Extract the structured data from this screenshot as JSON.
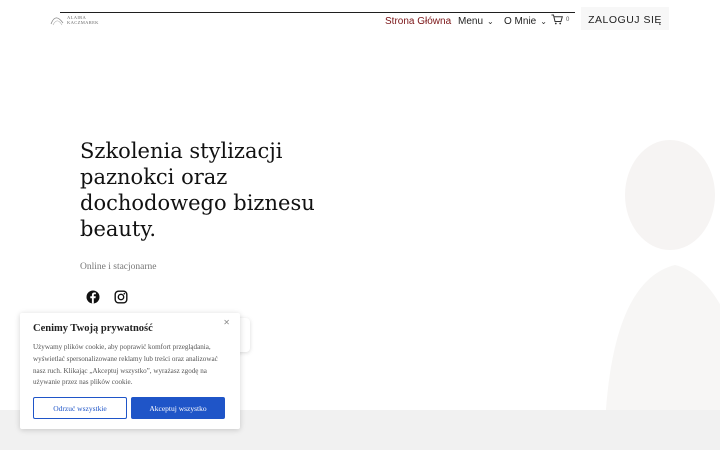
{
  "header": {
    "logo_text": "ALAIRA\nKACZMAREK",
    "nav": [
      {
        "label": "Strona Główna",
        "has_dropdown": false
      },
      {
        "label": "Menu",
        "has_dropdown": true
      },
      {
        "label": "O Mnie",
        "has_dropdown": true
      }
    ],
    "cart_count": "0",
    "login_label": "ZALOGUJ SIĘ",
    "accent_color": "#7a1416"
  },
  "hero": {
    "title": "Szkolenia stylizacji\npaznokci oraz\ndochodowego biznesu\nbeauty.",
    "subtitle": "Online i stacjonarne",
    "social": [
      "facebook-icon",
      "instagram-icon"
    ]
  },
  "cookie": {
    "title": "Cenimy Twoją prywatność",
    "text": "Używamy plików cookie, aby poprawić komfort przeglądania, wyświetlać spersonalizowane reklamy lub treści oraz analizować nasz ruch. Klikając „Akceptuj wszystko”, wyrażasz zgodę na używanie przez nas plików cookie.",
    "close": "✕",
    "reject_label": "Odrzuć wszystkie",
    "accept_label": "Akceptuj wszystko",
    "button_color": "#1f55c8"
  }
}
